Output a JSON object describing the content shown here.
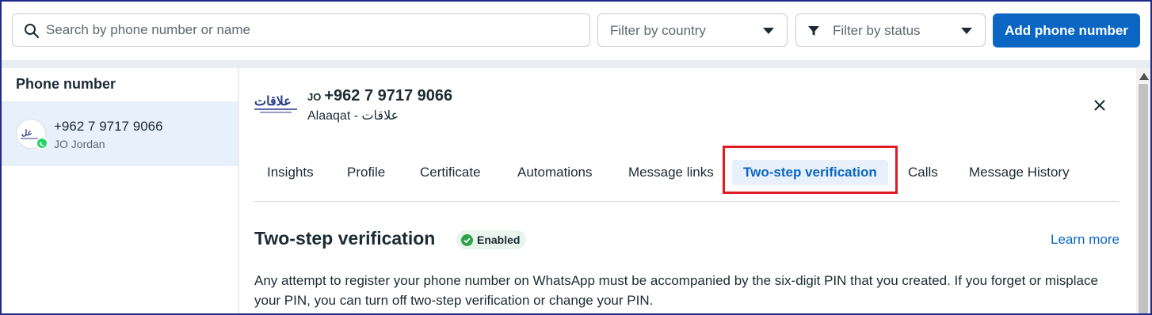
{
  "toolbar": {
    "search_placeholder": "Search by phone number or name",
    "country_filter": "Filter by country",
    "status_filter": "Filter by status",
    "add_button": "Add phone number"
  },
  "left_panel": {
    "header": "Phone number",
    "items": [
      {
        "number": "+962 7 9717 9066",
        "country": "JO Jordan"
      }
    ]
  },
  "detail": {
    "country_code": "JO",
    "number": "+962 7 9717 9066",
    "name": "Alaaqat - علاقات",
    "tabs": [
      {
        "label": "Insights"
      },
      {
        "label": "Profile"
      },
      {
        "label": "Certificate"
      },
      {
        "label": "Automations"
      },
      {
        "label": "Message links"
      },
      {
        "label": "Two-step verification"
      },
      {
        "label": "Calls"
      },
      {
        "label": "Message History"
      }
    ],
    "active_tab": "Two-step verification",
    "section_title": "Two-step verification",
    "status_badge": "Enabled",
    "learn_more": "Learn more",
    "description": "Any attempt to register your phone number on WhatsApp must be accompanied by the six-digit PIN that you created. If you forget or misplace your PIN, you can turn off two-step verification or change your PIN."
  },
  "colors": {
    "accent": "#0a66c2",
    "highlight_box": "#e01b24",
    "enabled_green": "#31a24c",
    "whatsapp_green": "#25d366"
  },
  "icons": [
    "search-icon",
    "filter-icon",
    "chevron-down-icon",
    "close-icon",
    "check-circle-icon",
    "whatsapp-icon"
  ]
}
